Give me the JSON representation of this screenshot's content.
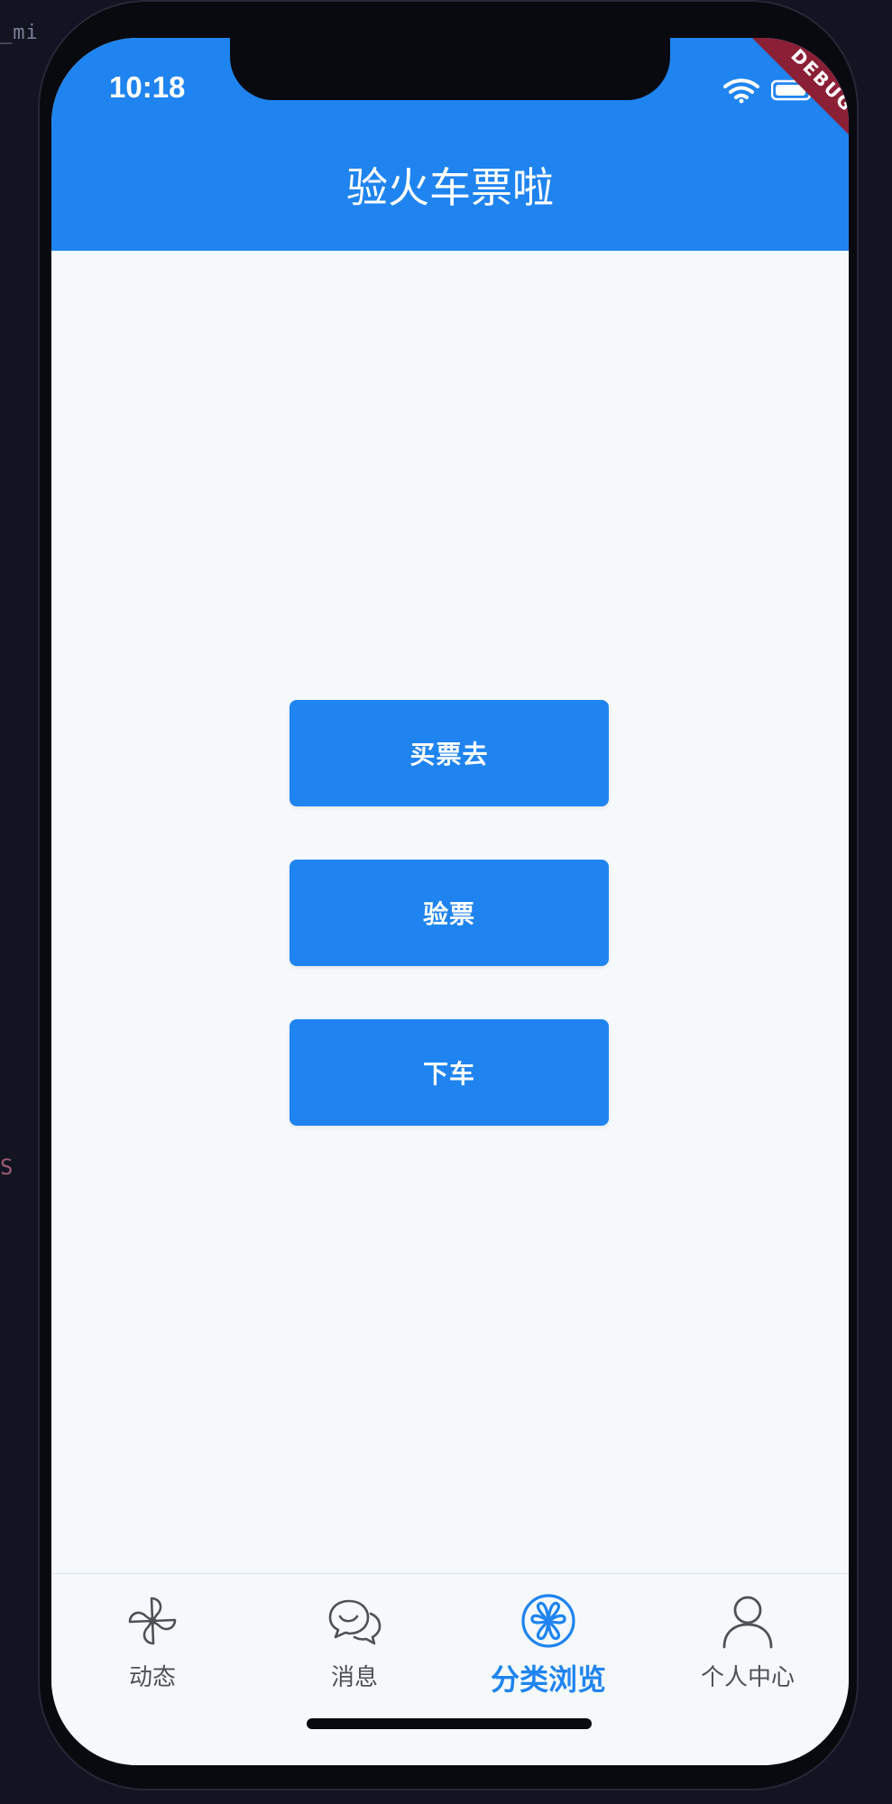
{
  "background": {
    "fragment_top": "_mi",
    "fragment_mid": "S"
  },
  "status_bar": {
    "time": "10:18",
    "debug_label": "DEBUG",
    "wifi_icon": "wifi-icon",
    "battery_icon": "battery-icon"
  },
  "app_bar": {
    "title": "验火车票啦"
  },
  "actions": [
    {
      "label": "买票去"
    },
    {
      "label": "验票"
    },
    {
      "label": "下车"
    }
  ],
  "bottom_nav": {
    "items": [
      {
        "label": "动态",
        "icon": "pinwheel-icon",
        "active": false
      },
      {
        "label": "消息",
        "icon": "chat-icon",
        "active": false
      },
      {
        "label": "分类浏览",
        "icon": "category-icon",
        "active": true
      },
      {
        "label": "个人中心",
        "icon": "person-icon",
        "active": false
      }
    ]
  },
  "colors": {
    "primary": "#1f84f0",
    "screen_background": "#f5f9fb",
    "inactive_text": "#4e5258",
    "debug_banner": "#8b1f36"
  }
}
